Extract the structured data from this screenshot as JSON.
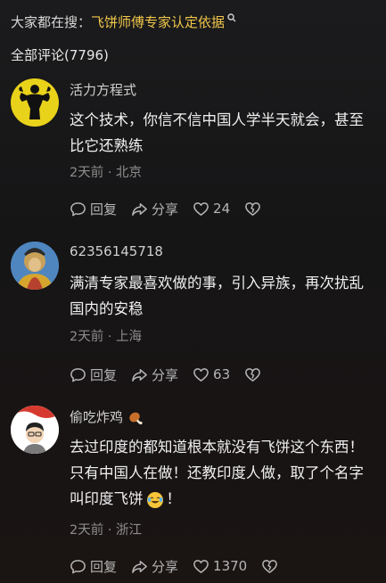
{
  "search": {
    "prefix": "大家都在搜：",
    "keyword": "飞饼师傅专家认定依据"
  },
  "header": {
    "total": "全部评论(7796)"
  },
  "comments": [
    {
      "username": "活力方程式",
      "text": "这个技术，你信不信中国人学半天就会，甚至比它还熟练",
      "meta": "2天前 · 北京",
      "reply": "回复",
      "share": "分享",
      "likes": "24"
    },
    {
      "username": "62356145718",
      "text": "满清专家最喜欢做的事，引入异族，再次扰乱国内的安稳",
      "meta": "2天前 · 上海",
      "reply": "回复",
      "share": "分享",
      "likes": "63"
    },
    {
      "username": "偷吃炸鸡",
      "text_before": "去过印度的都知道根本就没有飞饼这个东西！只有中国人在做！还教印度人做，取了个名字叫印度飞饼",
      "text_after": "！",
      "meta": "2天前 · 浙江",
      "reply": "回复",
      "share": "分享",
      "likes": "1370"
    }
  ]
}
